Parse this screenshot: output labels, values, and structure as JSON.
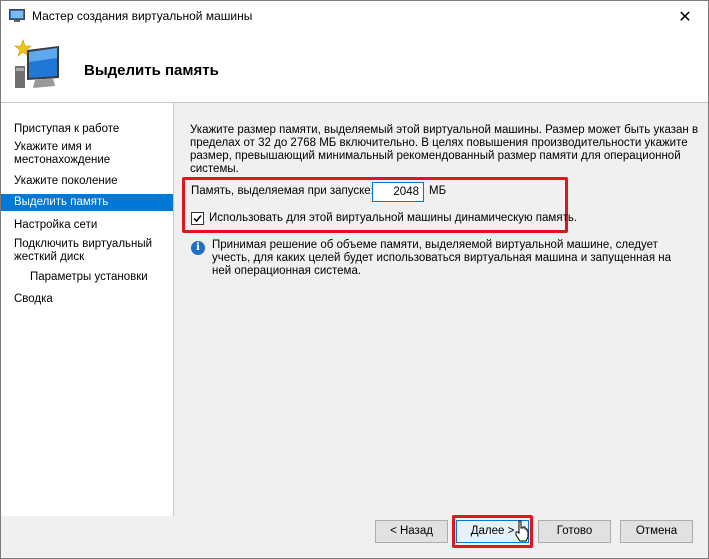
{
  "window": {
    "title": "Мастер создания виртуальной машины",
    "close_glyph": "✕"
  },
  "header": {
    "heading": "Выделить память",
    "icon": "wizard-monitor-star-icon"
  },
  "sidebar": {
    "items": [
      {
        "label": "Приступая к работе"
      },
      {
        "label": "Укажите имя и местонахождение"
      },
      {
        "label": "Укажите поколение"
      },
      {
        "label": "Выделить память",
        "active": true
      },
      {
        "label": "Настройка сети"
      },
      {
        "label": "Подключить виртуальный жесткий диск"
      },
      {
        "label": "Параметры установки",
        "sub": true
      },
      {
        "label": "Сводка"
      }
    ]
  },
  "content": {
    "intro": "Укажите размер памяти, выделяемый этой виртуальной машины. Размер может быть указан в пределах от 32 до 2768 МБ включительно. В целях повышения производительности укажите размер, превышающий минимальный рекомендованный размер памяти для операционной системы.",
    "memory_label": "Память, выделяемая при запуске:",
    "memory_value": "2048",
    "memory_unit": "МБ",
    "dynamic_memory_label": "Использовать для этой виртуальной машины динамическую память.",
    "dynamic_memory_checked": true,
    "info_text": "Принимая решение об объеме памяти, выделяемой виртуальной машине, следует учесть, для каких целей будет использоваться виртуальная машина и запущенная на ней операционная система."
  },
  "buttons": {
    "back": "< Назад",
    "next": "Далее >",
    "finish": "Готово",
    "cancel": "Отмена"
  },
  "colors": {
    "accent": "#0078d7",
    "highlight": "#e0161e"
  }
}
